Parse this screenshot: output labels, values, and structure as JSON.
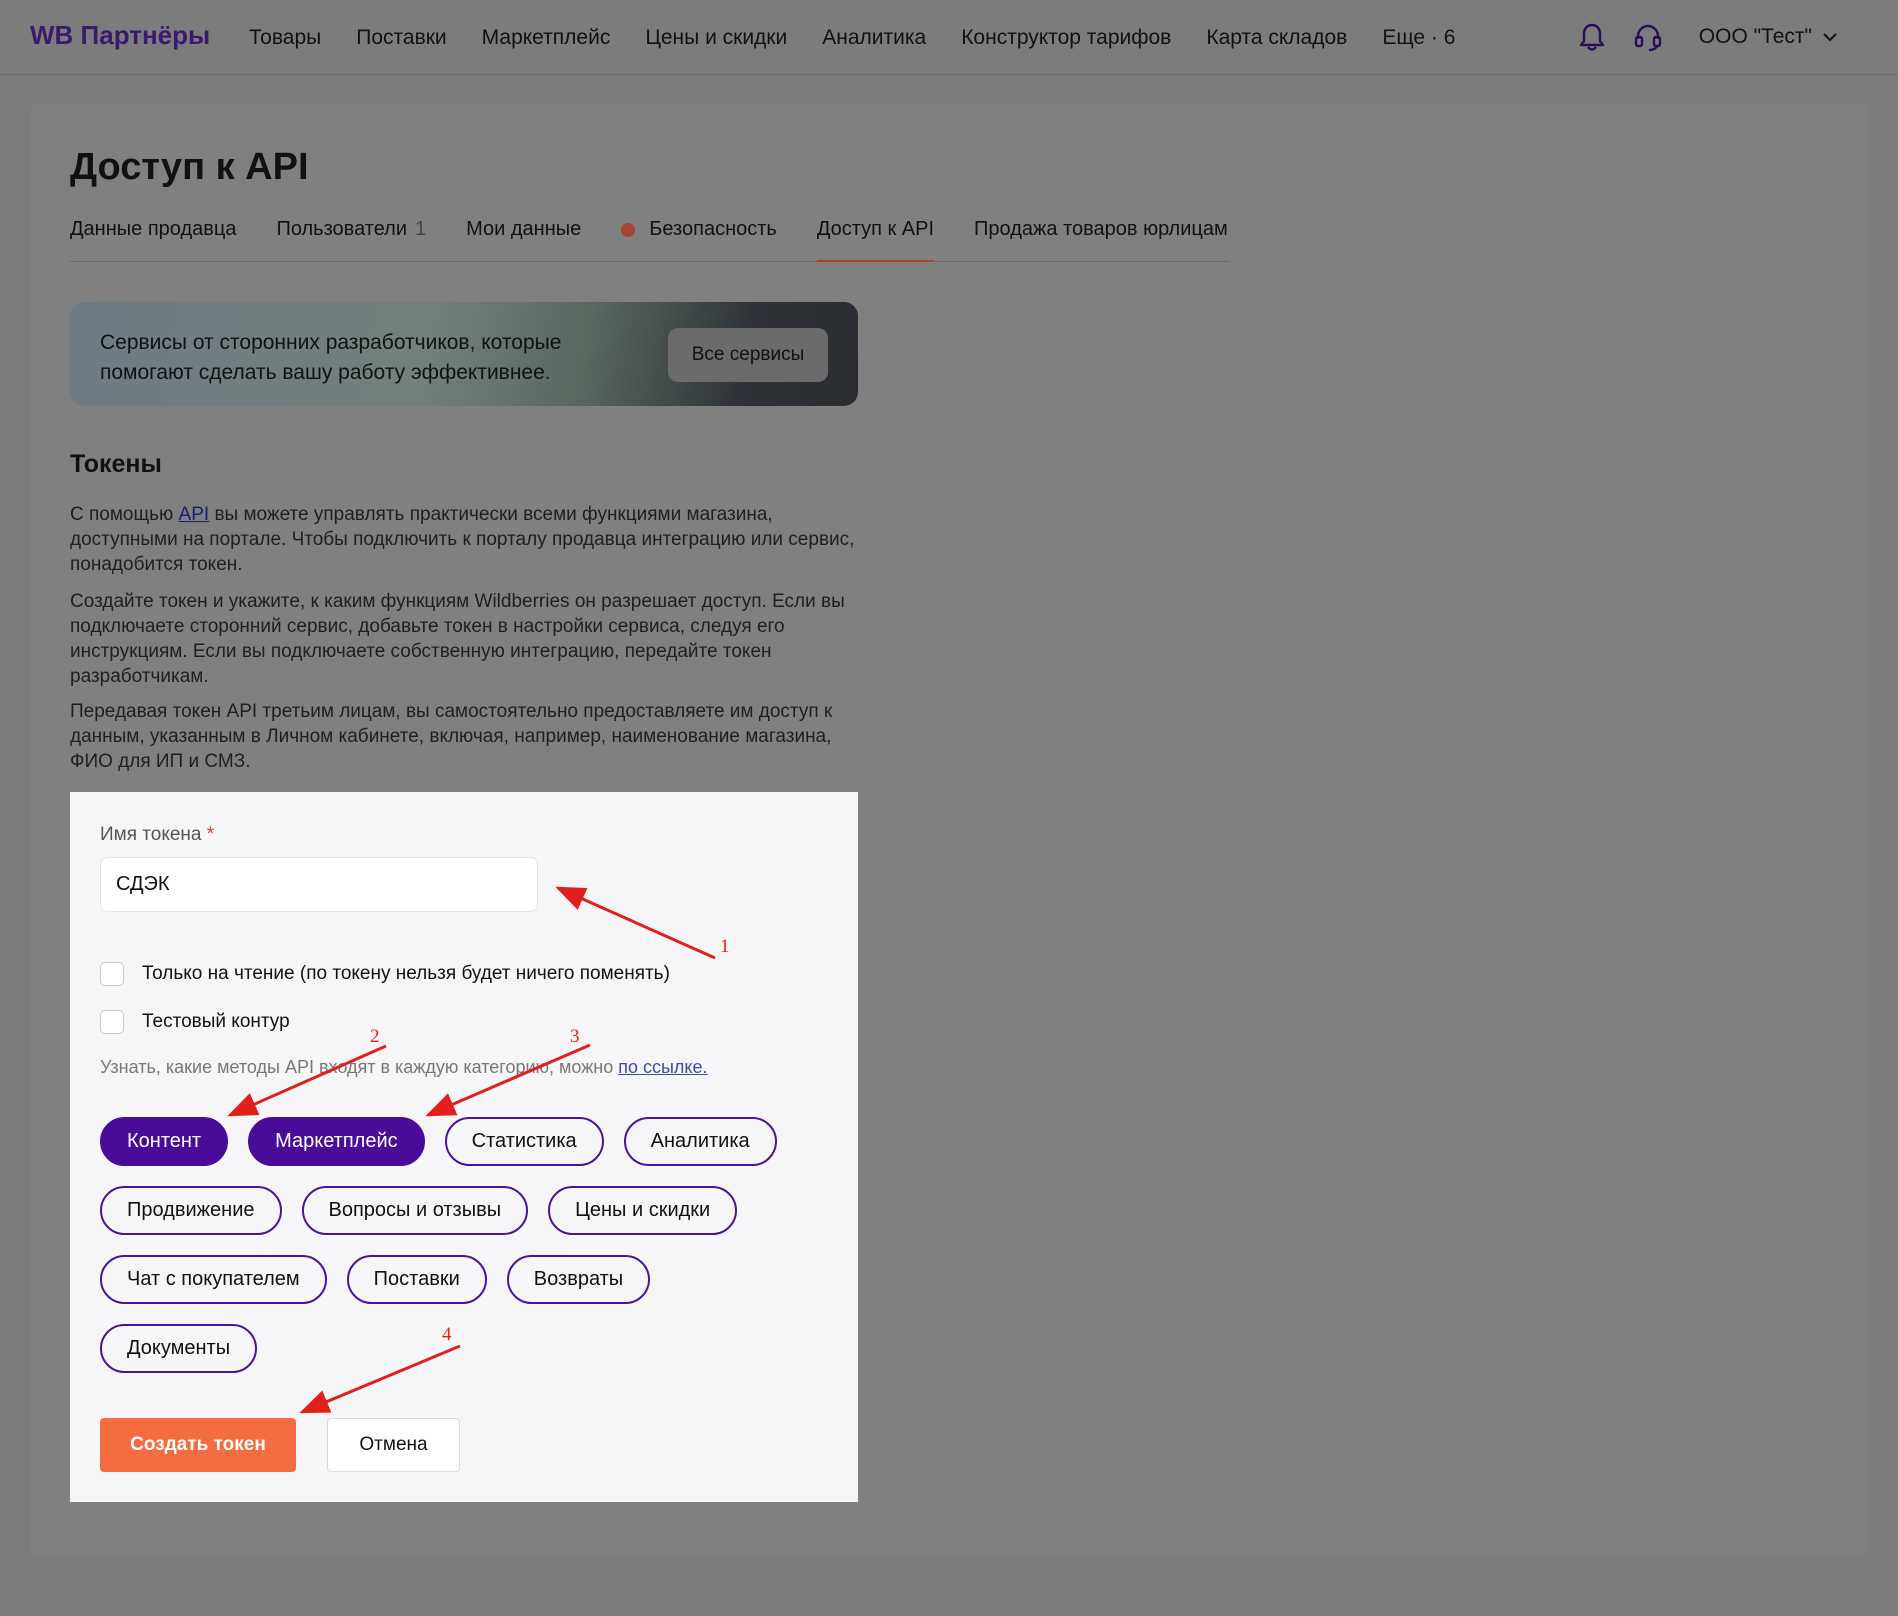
{
  "header": {
    "logo": "WB Партнёры",
    "nav": [
      "Товары",
      "Поставки",
      "Маркетплейс",
      "Цены и скидки",
      "Аналитика",
      "Конструктор тарифов",
      "Карта складов",
      "Еще · 6"
    ],
    "account": "ООО \"Тест\"",
    "icons": [
      "bell-icon",
      "headset-icon",
      "chevron-down-icon"
    ]
  },
  "page": {
    "title": "Доступ к API",
    "tabs": [
      {
        "label": "Данные продавца"
      },
      {
        "label": "Пользователи",
        "count": "1"
      },
      {
        "label": "Мои данные"
      },
      {
        "label": "Безопасность",
        "dot": true
      },
      {
        "label": "Доступ к API",
        "active": true
      },
      {
        "label": "Продажа товаров юрлицам"
      }
    ],
    "banner": {
      "text": "Сервисы от сторонних разработчиков, которые помогают сделать вашу работу эффективнее.",
      "button": "Все сервисы"
    },
    "tokens": {
      "title": "Токены",
      "p1_before": "С помощью ",
      "p1_link": "API",
      "p1_after": " вы можете управлять практически всеми функциями магазина, доступными на портале. Чтобы подключить к порталу продавца интеграцию или сервис, понадобится токен.",
      "p2": "Создайте токен и укажите, к каким функциям Wildberries он разрешает доступ. Если вы подключаете сторонний сервис, добавьте токен в настройки сервиса, следуя его инструкциям. Если вы подключаете собственную интеграцию, передайте токен разработчикам.",
      "p3": "Передавая токен API третьим лицам, вы самостоятельно предоставляете им доступ к данным, указанным в Личном кабинете, включая, например, наименование магазина, ФИО для ИП и СМЗ."
    }
  },
  "modal": {
    "name_label": "Имя токена",
    "required_mark": "*",
    "name_value": "СДЭК",
    "readonly_label": "Только на чтение (по токену нельзя будет ничего поменять)",
    "test_label": "Тестовый контур",
    "hint_text": "Узнать, какие методы API входят в каждую категорию, можно ",
    "hint_link": "по ссылке.",
    "categories": [
      {
        "label": "Контент",
        "selected": true
      },
      {
        "label": "Маркетплейс",
        "selected": true
      },
      {
        "label": "Статистика",
        "selected": false
      },
      {
        "label": "Аналитика",
        "selected": false
      },
      {
        "label": "Продвижение",
        "selected": false
      },
      {
        "label": "Вопросы и отзывы",
        "selected": false
      },
      {
        "label": "Цены и скидки",
        "selected": false
      },
      {
        "label": "Чат с покупателем",
        "selected": false
      },
      {
        "label": "Поставки",
        "selected": false
      },
      {
        "label": "Возвраты",
        "selected": false
      },
      {
        "label": "Документы",
        "selected": false
      }
    ],
    "create_button": "Создать токен",
    "cancel_button": "Отмена"
  },
  "annotations": {
    "numbers": [
      "1",
      "2",
      "3",
      "4"
    ],
    "color": "#e0201b"
  },
  "colors": {
    "brand_purple": "#4b0b99",
    "accent_orange": "#f46c3f",
    "overlay_gray": "#7c7c7c"
  }
}
